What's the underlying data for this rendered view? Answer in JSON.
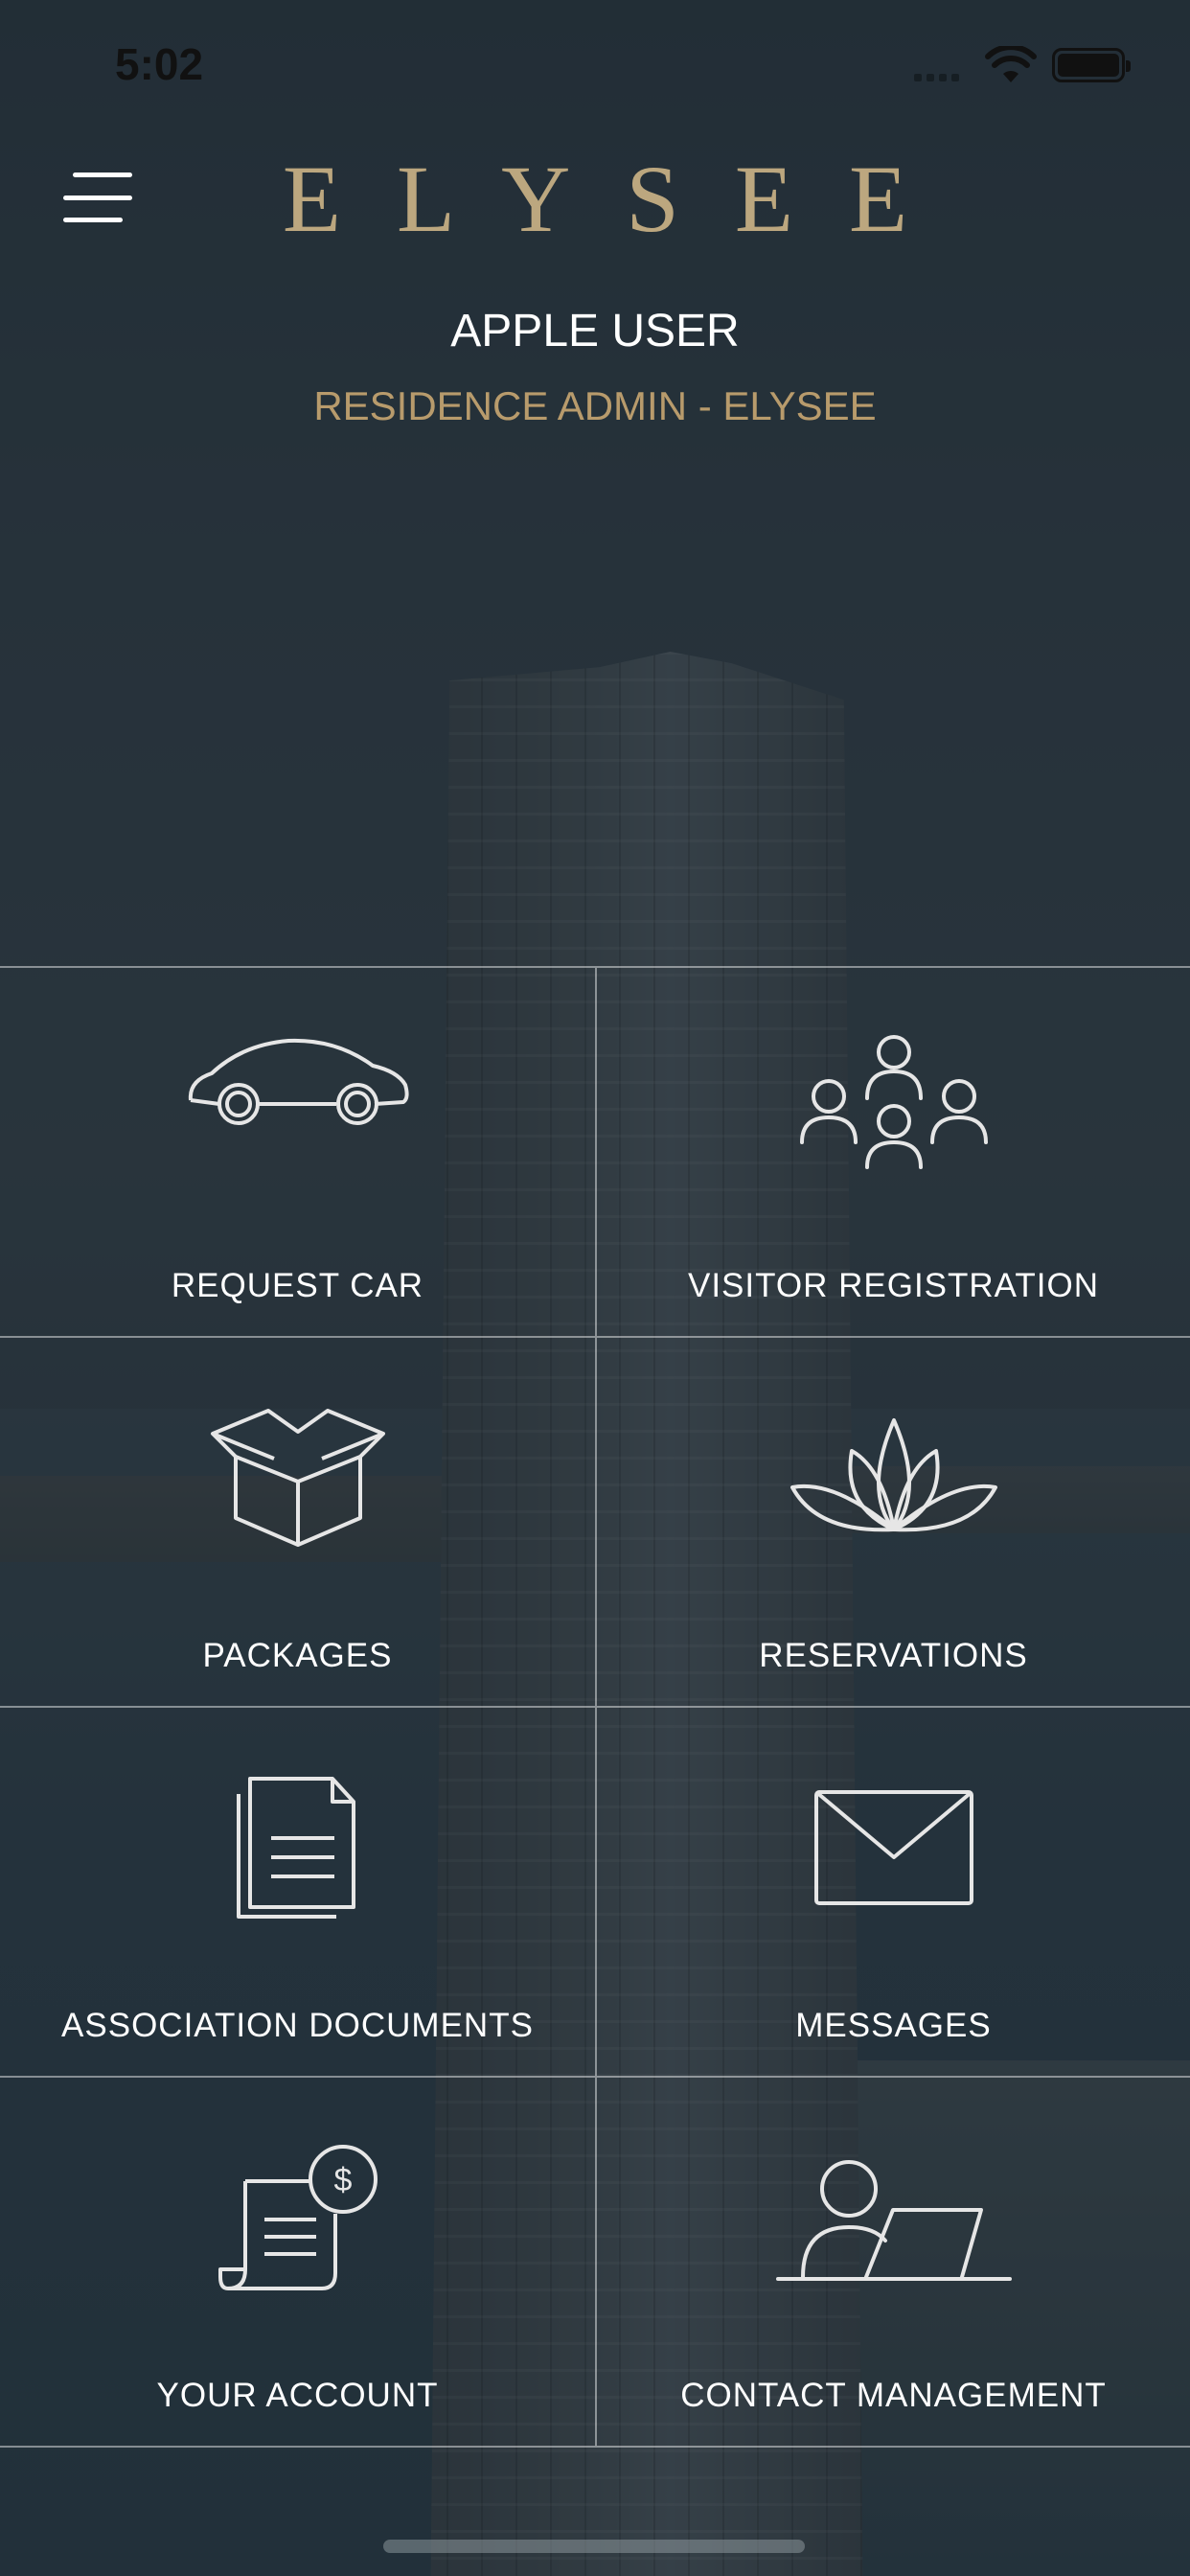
{
  "status_bar": {
    "time": "5:02"
  },
  "header": {
    "logo_text": "ELYSEE",
    "user_name": "APPLE USER",
    "user_role": "RESIDENCE ADMIN - ELYSEE"
  },
  "tiles": [
    {
      "label": "REQUEST CAR",
      "icon": "car-icon"
    },
    {
      "label": "VISITOR REGISTRATION",
      "icon": "people-icon"
    },
    {
      "label": "PACKAGES",
      "icon": "box-icon"
    },
    {
      "label": "RESERVATIONS",
      "icon": "lotus-icon"
    },
    {
      "label": "ASSOCIATION DOCUMENTS",
      "icon": "documents-icon"
    },
    {
      "label": "MESSAGES",
      "icon": "envelope-icon"
    },
    {
      "label": "YOUR ACCOUNT",
      "icon": "bill-icon"
    },
    {
      "label": "CONTACT MANAGEMENT",
      "icon": "user-laptop-icon"
    }
  ],
  "colors": {
    "logo_gold": "#bca77f",
    "role_gold": "#b89b6c",
    "line": "rgba(255,255,255,0.45)"
  }
}
